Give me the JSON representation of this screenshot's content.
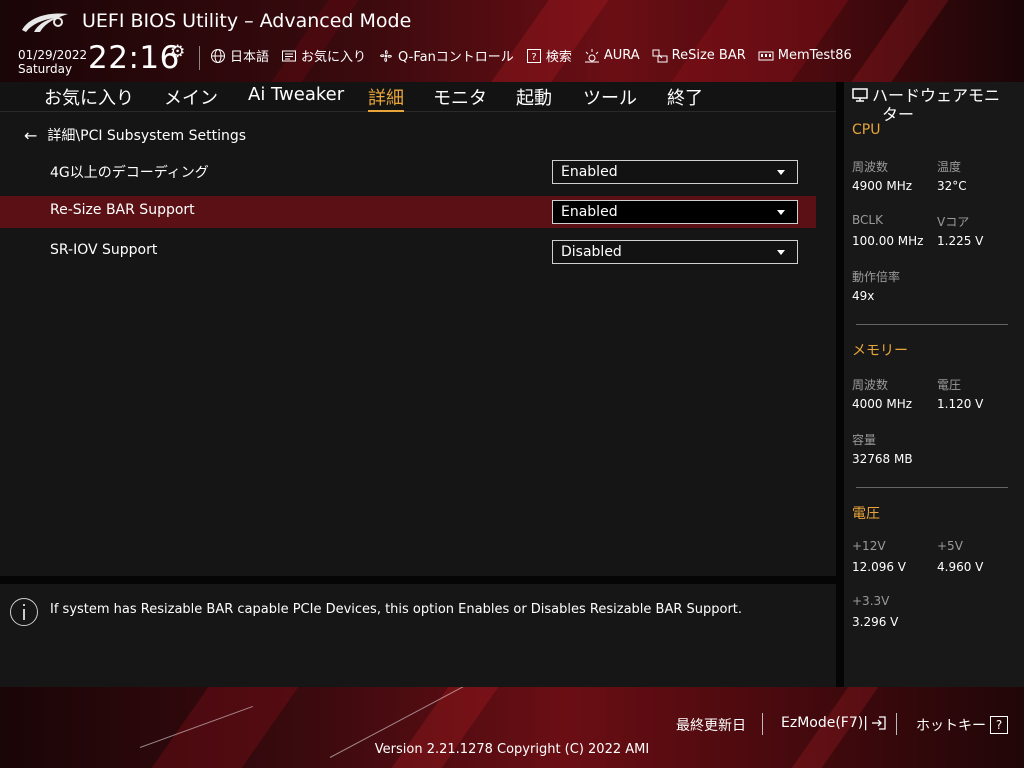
{
  "header": {
    "title": "UEFI BIOS Utility – Advanced Mode",
    "date": "01/29/2022",
    "day": "Saturday",
    "time": "22:16",
    "toolbar": [
      {
        "icon": "globe-icon",
        "label": "日本語"
      },
      {
        "icon": "favorites-icon",
        "label": "お気に入り"
      },
      {
        "icon": "fan-icon",
        "label": "Q-Fanコントロール"
      },
      {
        "icon": "search-icon",
        "label": "検索"
      },
      {
        "icon": "aura-icon",
        "label": "AURA"
      },
      {
        "icon": "resize-bar-icon",
        "label": "ReSize BAR"
      },
      {
        "icon": "memtest-icon",
        "label": "MemTest86"
      }
    ]
  },
  "tabs": [
    {
      "label": "お気に入り"
    },
    {
      "label": "メイン"
    },
    {
      "label": "Ai Tweaker"
    },
    {
      "label": "詳細",
      "active": true
    },
    {
      "label": "モニタ"
    },
    {
      "label": "起動"
    },
    {
      "label": "ツール"
    },
    {
      "label": "終了"
    }
  ],
  "breadcrumb": "詳細\\PCI Subsystem Settings",
  "settings": [
    {
      "label": "4G以上のデコーディング",
      "value": "Enabled"
    },
    {
      "label": "Re-Size BAR Support",
      "value": "Enabled",
      "selected": true
    },
    {
      "label": "SR-IOV Support",
      "value": "Disabled"
    }
  ],
  "help_text": "If system has Resizable BAR capable PCIe Devices, this option Enables or Disables Resizable BAR Support.",
  "hardware_monitor": {
    "title_line1": "ハードウェアモニ",
    "title_line2": "ター",
    "cpu": {
      "heading": "CPU",
      "freq_label": "周波数",
      "freq": "4900 MHz",
      "temp_label": "温度",
      "temp": "32°C",
      "bclk_label": "BCLK",
      "bclk": "100.00 MHz",
      "vcore_label": "Vコア",
      "vcore": "1.225 V",
      "ratio_label": "動作倍率",
      "ratio": "49x"
    },
    "memory": {
      "heading": "メモリー",
      "freq_label": "周波数",
      "freq": "4000 MHz",
      "volt_label": "電圧",
      "volt": "1.120 V",
      "cap_label": "容量",
      "cap": "32768 MB"
    },
    "voltage": {
      "heading": "電圧",
      "v12_label": "+12V",
      "v12": "12.096 V",
      "v5_label": "+5V",
      "v5": "4.960 V",
      "v33_label": "+3.3V",
      "v33": "3.296 V"
    }
  },
  "footer": {
    "last_modified": "最終更新日",
    "ezmode": "EzMode(F7)|",
    "hotkeys": "ホットキー",
    "hotkey_glyph": "?",
    "version": "Version 2.21.1278 Copyright (C) 2022 AMI"
  },
  "colors": {
    "accent": "#e8a53a",
    "selected_row": "#5a1014",
    "brand_red": "#6a0e14"
  }
}
